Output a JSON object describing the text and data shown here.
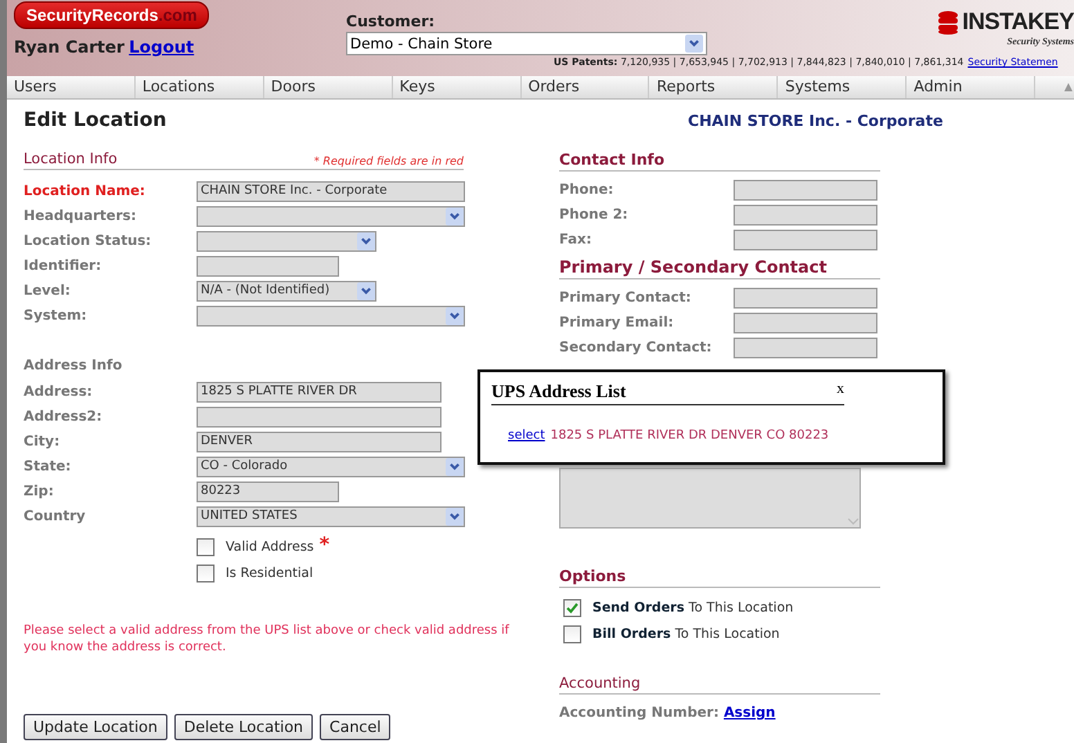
{
  "header": {
    "logo": {
      "name": "SecurityRecords",
      "suffix": ".com"
    },
    "user_name": "Ryan Carter",
    "logout": "Logout",
    "customer_label": "Customer:",
    "customer_select": {
      "value": "Demo - Chain Store"
    },
    "brand": {
      "name": "INSTAKEY",
      "tagline": "Security Systems"
    },
    "patents_label": "US Patents:",
    "patents": "7,120,935 | 7,653,945 | 7,702,913 | 7,844,823 | 7,840,010 | 7,861,314",
    "patents_link": "Security Statemen"
  },
  "nav": [
    {
      "label": "Users"
    },
    {
      "label": "Locations"
    },
    {
      "label": "Doors"
    },
    {
      "label": "Keys"
    },
    {
      "label": "Orders"
    },
    {
      "label": "Reports"
    },
    {
      "label": "Systems"
    },
    {
      "label": "Admin"
    }
  ],
  "page_title": "Edit Location",
  "location_heading": "CHAIN STORE Inc. - Corporate",
  "location_info": {
    "title": "Location Info",
    "required_note": "* Required fields are in red",
    "fields": [
      {
        "label": "Location Name:",
        "kind": "text",
        "value": "CHAIN STORE Inc. - Corporate",
        "required": true
      },
      {
        "label": "Headquarters:",
        "kind": "select",
        "required": false
      },
      {
        "label": "Location Status:",
        "kind": "select",
        "required": false
      },
      {
        "label": "Identifier:",
        "kind": "text",
        "required": false
      },
      {
        "label": "Level:",
        "kind": "select",
        "value": "N/A - (Not Identified)",
        "required": false
      },
      {
        "label": "System:",
        "kind": "select",
        "required": false
      }
    ]
  },
  "address_info": {
    "title": "Address Info",
    "fields": [
      {
        "label": "Address:",
        "kind": "text",
        "value": "1825 S PLATTE RIVER DR",
        "required": false
      },
      {
        "label": "Address2:",
        "kind": "text",
        "required": false
      },
      {
        "label": "City:",
        "kind": "text",
        "value": "DENVER",
        "required": false
      },
      {
        "label": "State:",
        "kind": "select",
        "value": "CO - Colorado",
        "required": false
      },
      {
        "label": "Zip:",
        "kind": "text",
        "value": "80223",
        "required": false
      },
      {
        "label": "Country",
        "kind": "select",
        "value": "UNITED STATES",
        "required": false
      }
    ],
    "checkboxes": [
      {
        "label": "Valid Address",
        "checked": false,
        "marker": "*"
      },
      {
        "label": "Is Residential",
        "checked": false
      }
    ]
  },
  "message": "Please select a valid address from the UPS list above or check valid address if you know the address is correct.",
  "buttons": [
    "Update Location",
    "Delete Location",
    "Cancel"
  ],
  "contact_info": {
    "title": "Contact Info",
    "fields": [
      {
        "label": "Phone:"
      },
      {
        "label": "Phone 2:"
      },
      {
        "label": "Fax:"
      }
    ]
  },
  "contacts": {
    "title": "Primary / Secondary Contact",
    "fields": [
      {
        "label": "Primary Contact:"
      },
      {
        "label": "Primary Email:"
      },
      {
        "label": "Secondary Contact:"
      }
    ]
  },
  "options": {
    "title": "Options",
    "items": [
      {
        "label": "**Send Orders** To This Location",
        "checked": true
      },
      {
        "label": "**Bill Orders** To This Location",
        "checked": false
      }
    ]
  },
  "accounting": {
    "title": "Accounting",
    "label": "Accounting Number:",
    "link": "Assign"
  },
  "popup": {
    "title": "UPS Address List",
    "close": "x",
    "entries": [
      {
        "link": "select",
        "address": "1825 S PLATTE RIVER DR DENVER CO 80223"
      }
    ]
  }
}
